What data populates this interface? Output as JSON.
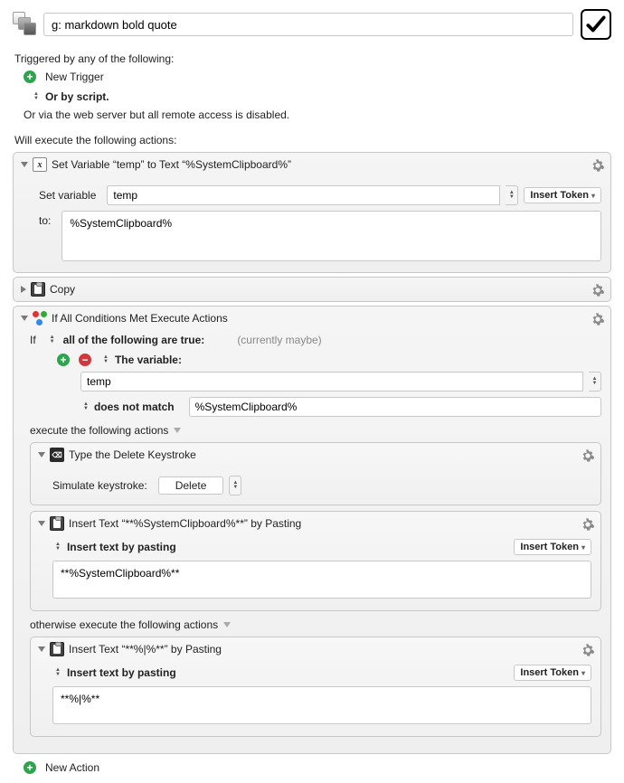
{
  "header": {
    "title": "g: markdown bold quote"
  },
  "trigger": {
    "intro": "Triggered by any of the following:",
    "new_trigger": "New Trigger",
    "or_script": "Or by script.",
    "web_note": "Or via the web server but all remote access is disabled."
  },
  "exec_intro": "Will execute the following actions:",
  "actions": {
    "setvar": {
      "title": "Set Variable “temp” to Text “%SystemClipboard%”",
      "label_set": "Set variable",
      "var_name": "temp",
      "insert_token": "Insert Token",
      "to_label": "to:",
      "to_value": "%SystemClipboard%"
    },
    "copy": {
      "title": "Copy"
    },
    "cond": {
      "title": "If All Conditions Met Execute Actions",
      "if_label": "If",
      "all_true": "all of the following are true:",
      "status": "(currently maybe)",
      "var_heading": "The variable:",
      "var_name": "temp",
      "op": "does not match",
      "rhs": "%SystemClipboard%",
      "then_label": "execute the following actions",
      "key": {
        "title": "Type the Delete Keystroke",
        "sim_label": "Simulate keystroke:",
        "key_name": "Delete"
      },
      "ins1": {
        "title": "Insert Text “**%SystemClipboard%**” by Pasting",
        "mode": "Insert text by pasting",
        "insert_token": "Insert Token",
        "value": "**%SystemClipboard%**"
      },
      "else_label": "otherwise execute the following actions",
      "ins2": {
        "title": "Insert Text “**%|%**” by Pasting",
        "mode": "Insert text by pasting",
        "insert_token": "Insert Token",
        "value": "**%|%**"
      }
    }
  },
  "footer": {
    "new_action": "New Action"
  }
}
